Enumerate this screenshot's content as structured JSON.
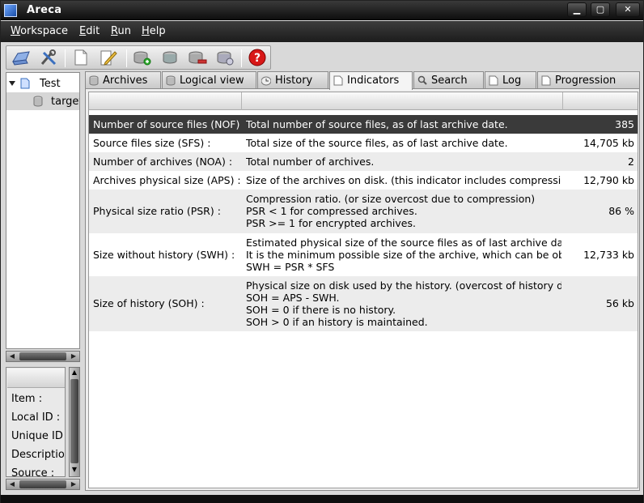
{
  "window": {
    "title": "Areca"
  },
  "window_controls": {
    "minimize": "▁",
    "maximize": "▢",
    "close": "✕"
  },
  "menu": [
    {
      "label": "Workspace",
      "mnemonic": "W",
      "rest": "orkspace"
    },
    {
      "label": "Edit",
      "mnemonic": "E",
      "rest": "dit"
    },
    {
      "label": "Run",
      "mnemonic": "R",
      "rest": "un"
    },
    {
      "label": "Help",
      "mnemonic": "H",
      "rest": "elp"
    }
  ],
  "toolbar": {
    "icons": [
      "open-workspace-icon",
      "preferences-icon",
      "new-document-icon",
      "edit-icon",
      "add-archive-icon",
      "merge-icon",
      "delete-icon",
      "check-icon",
      "help-icon"
    ]
  },
  "tree": {
    "items": [
      {
        "label": "Test",
        "icon": "document-icon"
      },
      {
        "label": "target",
        "icon": "database-icon"
      }
    ]
  },
  "properties": {
    "labels": [
      "Item :",
      "Local ID :",
      "Unique ID :",
      "Description :",
      "Source :"
    ]
  },
  "tabs": [
    {
      "label": "Archives",
      "icon": "database-icon"
    },
    {
      "label": "Logical view",
      "icon": "database-icon"
    },
    {
      "label": "History",
      "icon": "clock-icon"
    },
    {
      "label": "Indicators",
      "icon": "document-icon",
      "active": true
    },
    {
      "label": "Search",
      "icon": "search-icon"
    },
    {
      "label": "Log",
      "icon": "document-icon"
    },
    {
      "label": "Progression",
      "icon": "document-icon"
    }
  ],
  "indicators": {
    "rows": [
      {
        "name": "Number of source files (NOF)",
        "desc": [
          "Total number of source files, as of last archive date."
        ],
        "value": "385",
        "selected": true
      },
      {
        "name": "Source files size (SFS) :",
        "desc": [
          "Total size of the source files, as of last archive date."
        ],
        "value": "14,705 kb"
      },
      {
        "name": "Number of archives (NOA) :",
        "desc": [
          "Total number of archives."
        ],
        "value": "2"
      },
      {
        "name": "Archives physical size (APS) :",
        "desc": [
          "Size of the archives on disk. (this indicator includes compression"
        ],
        "value": "12,790 kb"
      },
      {
        "name": "Physical size ratio (PSR) :",
        "desc": [
          "Compression ratio. (or size overcost due to compression)",
          "PSR < 1 for compressed archives.",
          "PSR >= 1 for encrypted archives."
        ],
        "value": "86 %"
      },
      {
        "name": "Size without history (SWH) :",
        "desc": [
          "Estimated physical size of the source files as of last archive date",
          "It is the minimum possible size of the archive, which can be obtained",
          "SWH = PSR * SFS"
        ],
        "value": "12,733 kb"
      },
      {
        "name": "Size of history (SOH) :",
        "desc": [
          "Physical size on disk used by the history. (overcost of history data",
          "SOH = APS - SWH.",
          "SOH = 0 if there is no history.",
          "SOH > 0 if an history is maintained."
        ],
        "value": "56 kb"
      }
    ]
  },
  "colors": {
    "selected_row": "#3a3a3a",
    "alt_row": "#ececec",
    "titlebar": "#1a1a1a"
  }
}
